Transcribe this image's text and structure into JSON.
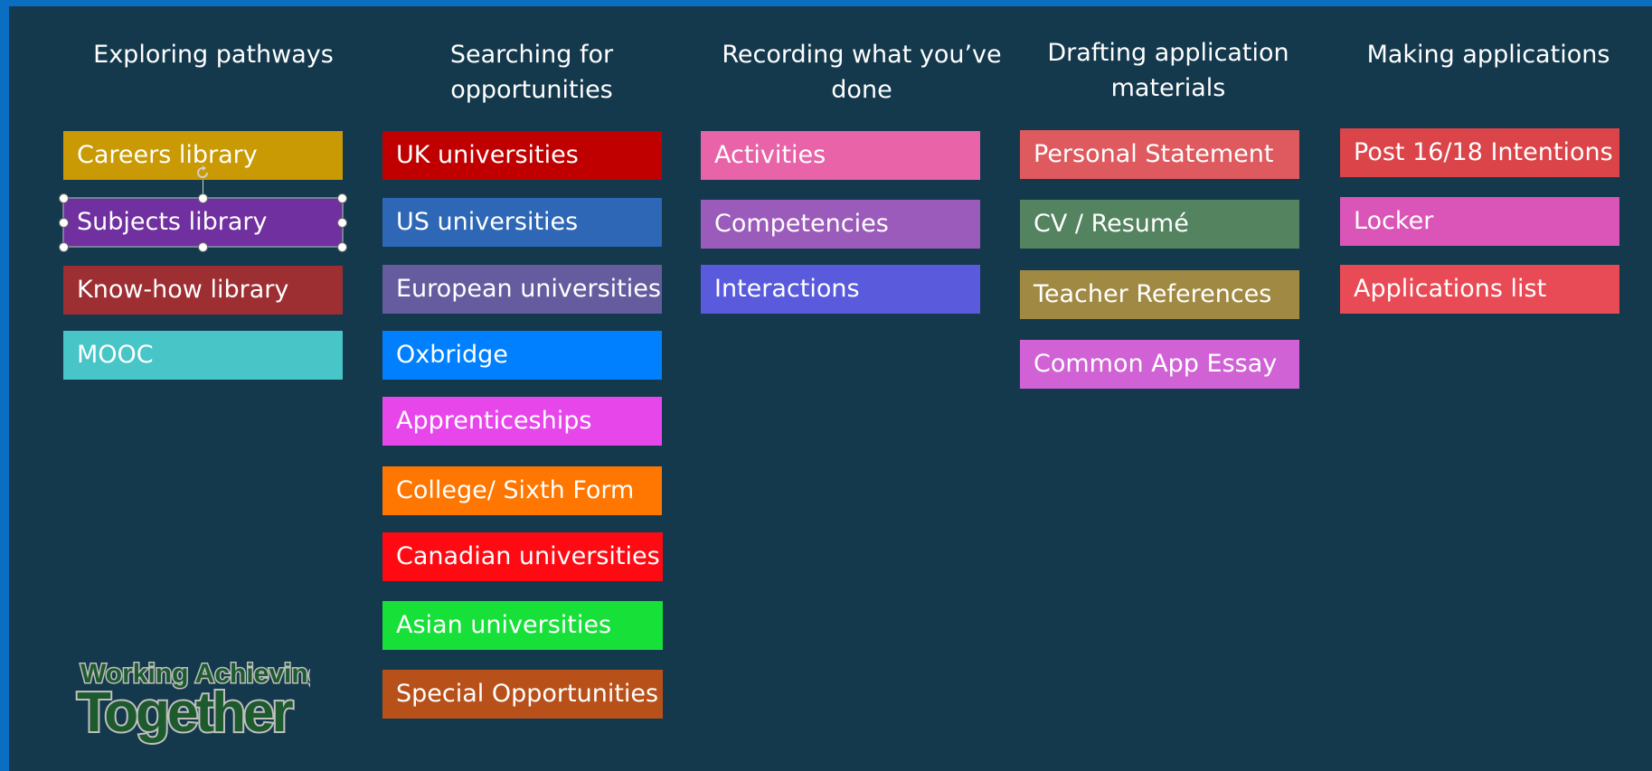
{
  "columns": [
    {
      "header": "Exploring pathways",
      "items": [
        {
          "label": "Careers library",
          "color": "#c99a03"
        },
        {
          "label": "Subjects library",
          "color": "#7030a0"
        },
        {
          "label": "Know-how library",
          "color": "#9d2e32"
        },
        {
          "label": "MOOC",
          "color": "#48c5c7"
        }
      ]
    },
    {
      "header": "Searching for\nopportunities",
      "items": [
        {
          "label": "UK universities",
          "color": "#c00000"
        },
        {
          "label": "US universities",
          "color": "#2e67b5"
        },
        {
          "label": "European universities",
          "color": "#655c9f"
        },
        {
          "label": "Oxbridge",
          "color": "#0080ff"
        },
        {
          "label": "Apprenticeships",
          "color": "#e646ea"
        },
        {
          "label": "College/ Sixth Form",
          "color": "#ff7600"
        },
        {
          "label": "Canadian universities",
          "color": "#ff0a13"
        },
        {
          "label": "Asian universities",
          "color": "#17e039"
        },
        {
          "label": "Special Opportunities",
          "color": "#b8501a"
        }
      ]
    },
    {
      "header": "Recording what you’ve\ndone",
      "items": [
        {
          "label": "Activities",
          "color": "#e863a8"
        },
        {
          "label": "Competencies",
          "color": "#9b5bba"
        },
        {
          "label": "Interactions",
          "color": "#5a5bdc"
        }
      ]
    },
    {
      "header": "Drafting application\nmaterials",
      "items": [
        {
          "label": "Personal Statement",
          "color": "#de5a5e"
        },
        {
          "label": "CV / Resumé",
          "color": "#53835f"
        },
        {
          "label": "Teacher References",
          "color": "#a08a43"
        },
        {
          "label": "Common App Essay",
          "color": "#d062d6"
        }
      ]
    },
    {
      "header": "Making applications",
      "items": [
        {
          "label": "Post 16/18 Intentions",
          "color": "#db4449"
        },
        {
          "label": "Locker",
          "color": "#da55b7"
        },
        {
          "label": "Applications list",
          "color": "#e84b55"
        }
      ]
    }
  ],
  "logo": {
    "line1": "Working Achieving",
    "line2": "Together"
  }
}
